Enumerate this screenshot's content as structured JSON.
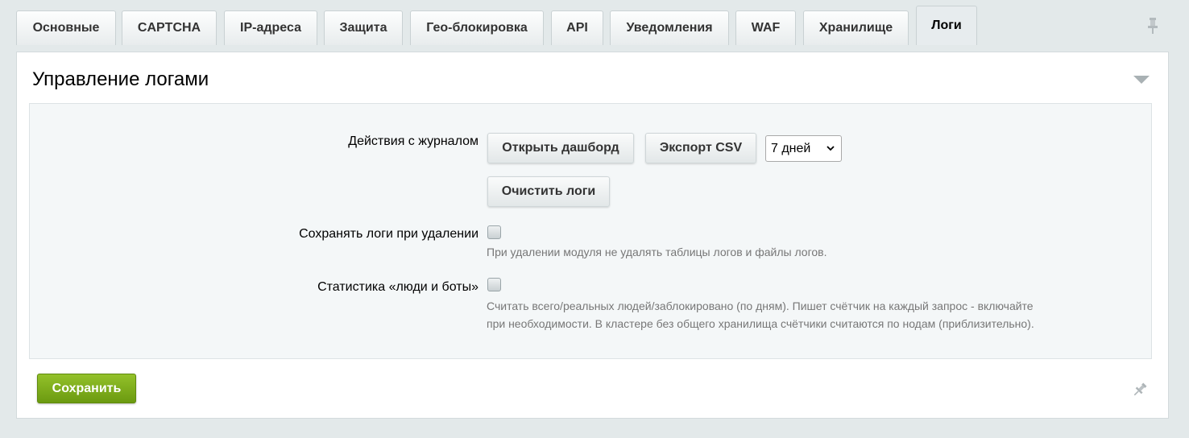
{
  "tabs": [
    {
      "label": "Основные"
    },
    {
      "label": "CAPTCHA"
    },
    {
      "label": "IP-адреса"
    },
    {
      "label": "Защита"
    },
    {
      "label": "Гео-блокировка"
    },
    {
      "label": "API"
    },
    {
      "label": "Уведомления"
    },
    {
      "label": "WAF"
    },
    {
      "label": "Хранилище"
    },
    {
      "label": "Логи",
      "active": true
    }
  ],
  "section": {
    "title": "Управление логами"
  },
  "journal_actions": {
    "label": "Действия с журналом",
    "open_dashboard": "Открыть дашборд",
    "export_csv": "Экспорт CSV",
    "period_selected": "7 дней",
    "clear_logs": "Очистить логи"
  },
  "keep_logs": {
    "label": "Сохранять логи при удалении",
    "checked": false,
    "hint": "При удалении модуля не удалять таблицы логов и файлы логов."
  },
  "stats": {
    "label": "Статистика «люди и боты»",
    "checked": false,
    "hint_line1": "Считать всего/реальных людей/заблокировано (по дням). Пишет счётчик на каждый запрос - включайте",
    "hint_line2": "при необходимости. В кластере без общего хранилища счётчики считаются по нодам (приблизительно)."
  },
  "footer": {
    "save": "Сохранить"
  },
  "colors": {
    "background": "#e3e9ea",
    "save_button": "#7aa916",
    "hint_text": "#777777"
  }
}
